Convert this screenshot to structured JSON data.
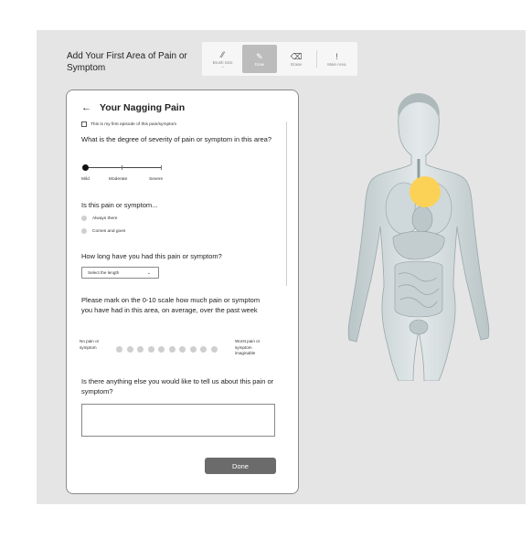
{
  "header": {
    "title": "Add Your First Area of Pain or Symptom"
  },
  "toolbar": {
    "tools": [
      {
        "label": "Brush Size",
        "icon": "brush-size-icon"
      },
      {
        "label": "Draw",
        "icon": "draw-brush-icon",
        "active": true
      },
      {
        "label": "Erase",
        "icon": "eraser-icon"
      },
      {
        "label": "Main Area",
        "icon": "exclamation-icon"
      }
    ]
  },
  "card": {
    "title": "Your Nagging Pain",
    "first_episode_label": "This is my first episode of this pain/symptom",
    "q_severity": "What is the degree of severity of pain or symptom in this area?",
    "severity_slider": {
      "labels": [
        "Mild",
        "Moderate",
        "Severe"
      ],
      "value": "Mild"
    },
    "q_frequency": "Is this pain or symptom...",
    "frequency_options": [
      "Always there",
      "Comes and goes"
    ],
    "q_duration": "How long have you had this pain or symptom?",
    "duration_select": {
      "placeholder": "Select the length"
    },
    "q_scale": "Please mark on the 0-10 scale how much pain or symptom you have had in this area, on average, over the past week",
    "scale": {
      "left_label": "No pain or symptom",
      "right_label": "Worst pain or symptom imaginable",
      "points": 10
    },
    "q_other": "Is there anything else you would like to tell us about this pain or symptom?",
    "done_label": "Done"
  },
  "colors": {
    "accent": "#fbd256",
    "button": "#6b6b6b",
    "canvas": "#e5e5e5"
  }
}
